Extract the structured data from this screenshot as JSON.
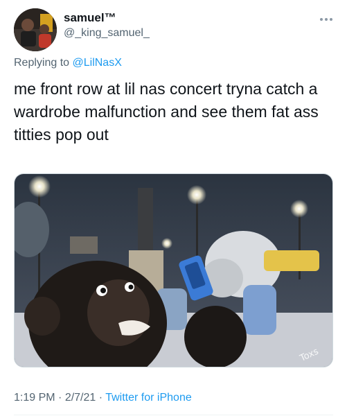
{
  "author": {
    "display_name": "samuel™",
    "handle": "@_king_samuel_",
    "avatar_icon": "profile-photo"
  },
  "reply": {
    "prefix": "Replying to ",
    "mention": "@LilNasX"
  },
  "tweet": {
    "text": "me front row at lil nas concert tryna catch a wardrobe malfunction and see them fat ass titties pop out"
  },
  "media": {
    "watermark": "Toxs"
  },
  "footer": {
    "time": "1:19 PM",
    "sep1": " · ",
    "date": "2/7/21",
    "sep2": " · ",
    "source": "Twitter for iPhone"
  },
  "icons": {
    "more": "more-icon"
  },
  "colors": {
    "accent": "#1d9bf0",
    "secondary_text": "#536471",
    "primary_text": "#0f1419"
  }
}
